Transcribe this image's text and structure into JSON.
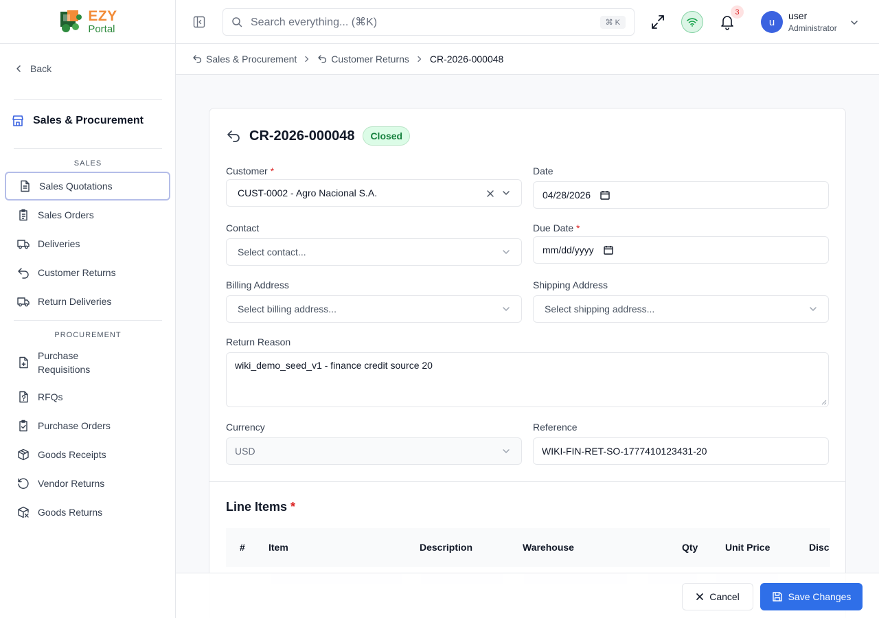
{
  "app": {
    "logo_top": "EZY",
    "logo_bottom": "Portal"
  },
  "sidebar": {
    "back_label": "Back",
    "module_title": "Sales & Procurement",
    "sections": [
      {
        "label": "SALES",
        "items": [
          "Sales Quotations",
          "Sales Orders",
          "Deliveries",
          "Customer Returns",
          "Return Deliveries"
        ]
      },
      {
        "label": "PROCUREMENT",
        "items": [
          "Purchase Requisitions",
          "RFQs",
          "Purchase Orders",
          "Goods Receipts",
          "Vendor Returns",
          "Goods Returns"
        ]
      }
    ],
    "active_item": "Sales Quotations"
  },
  "header": {
    "search_placeholder": "Search everything... (⌘K)",
    "search_shortcut": "⌘ K",
    "notification_count": "3",
    "avatar_initial": "u",
    "user_name": "user",
    "user_role": "Administrator"
  },
  "breadcrumb": [
    "Sales & Procurement",
    "Customer Returns",
    "CR-2026-000048"
  ],
  "form": {
    "title": "CR-2026-000048",
    "status": "Closed",
    "customer_label": "Customer",
    "customer_value": "CUST-0002 - Agro Nacional S.A.",
    "date_label": "Date",
    "date_value": "04/28/2026",
    "contact_label": "Contact",
    "contact_placeholder": "Select contact...",
    "due_date_label": "Due Date",
    "due_date_value": "mm/dd/yyyy",
    "billing_label": "Billing Address",
    "billing_placeholder": "Select billing address...",
    "shipping_label": "Shipping Address",
    "shipping_placeholder": "Select shipping address...",
    "return_reason_label": "Return Reason",
    "return_reason_value": "wiki_demo_seed_v1 - finance credit source 20",
    "currency_label": "Currency",
    "currency_value": "USD",
    "reference_label": "Reference",
    "reference_value": "WIKI-FIN-RET-SO-1777410123431-20",
    "required_mark": "*"
  },
  "line_items": {
    "title": "Line Items",
    "columns": [
      "#",
      "Item",
      "Description",
      "Warehouse",
      "Qty",
      "Unit Price",
      "Disc"
    ]
  },
  "footer": {
    "cancel_label": "Cancel",
    "save_label": "Save Changes"
  },
  "colors": {
    "primary": "#2f6fe8",
    "status_closed": "#15803d",
    "required": "#dc2626",
    "logo_orange": "#f28c38",
    "logo_green": "#2e8b3e"
  }
}
